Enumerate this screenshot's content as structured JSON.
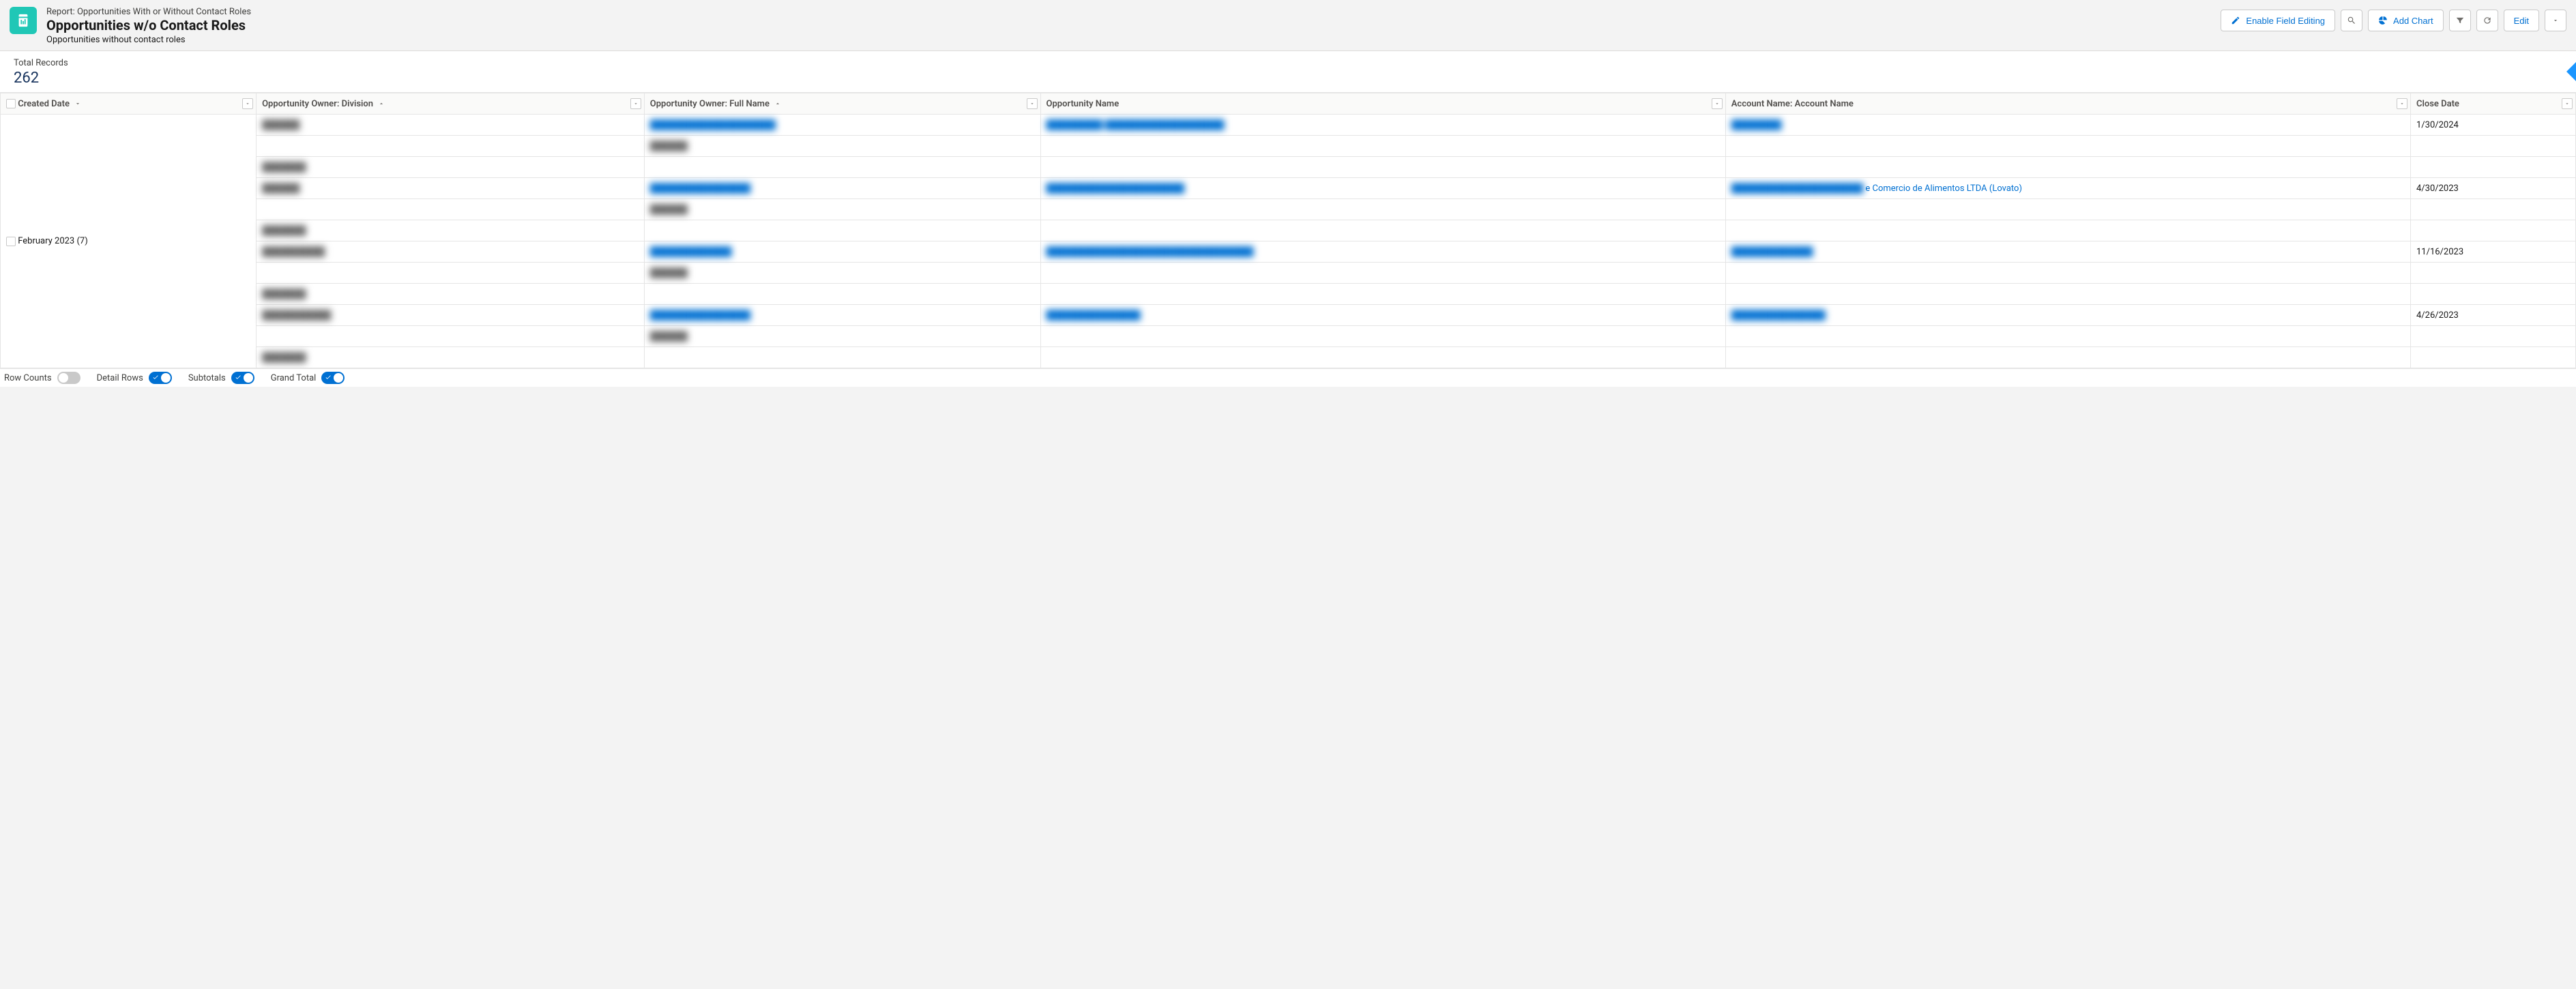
{
  "header": {
    "type_label": "Report: Opportunities With or Without Contact Roles",
    "title": "Opportunities w/o Contact Roles",
    "description": "Opportunities without contact roles",
    "actions": {
      "enable_editing": "Enable Field Editing",
      "add_chart": "Add Chart",
      "edit": "Edit"
    }
  },
  "summary": {
    "label": "Total Records",
    "value": "262"
  },
  "columns": {
    "created_date": "Created Date",
    "division": "Opportunity Owner: Division",
    "fullname": "Opportunity Owner: Full Name",
    "opp_name": "Opportunity Name",
    "account": "Account Name: Account Name",
    "close_date": "Close Date"
  },
  "group": {
    "label": "February 2023",
    "count": "(7)"
  },
  "rows": [
    {
      "division": "██████",
      "fullname": "████████████████████",
      "opp_name": "█████████   ███████████████████",
      "account": "████████",
      "close_date": "1/30/2024"
    },
    {
      "division": "",
      "fullname": "██████",
      "opp_name": "",
      "account": "",
      "close_date": ""
    },
    {
      "division": "███████",
      "fullname": "",
      "opp_name": "",
      "account": "",
      "close_date": ""
    },
    {
      "division": "██████",
      "fullname": "████████████████",
      "opp_name": "██████████████████████",
      "account_prefix": "█████████████████████",
      "account_suffix": " e Comercio de Alimentos LTDA (Lovato)",
      "close_date": "4/30/2023"
    },
    {
      "division": "",
      "fullname": "██████",
      "opp_name": "",
      "account": "",
      "close_date": ""
    },
    {
      "division": "███████",
      "fullname": "",
      "opp_name": "",
      "account": "",
      "close_date": ""
    },
    {
      "division": "██████████",
      "fullname": "█████████████",
      "opp_name": "█████████████████████████████████",
      "account": "█████████████",
      "close_date": "11/16/2023"
    },
    {
      "division": "",
      "fullname": "██████",
      "opp_name": "",
      "account": "",
      "close_date": ""
    },
    {
      "division": "███████",
      "fullname": "",
      "opp_name": "",
      "account": "",
      "close_date": ""
    },
    {
      "division": "███████████",
      "fullname": "████████████████",
      "opp_name": "███████████████",
      "account": "███████████████",
      "close_date": "4/26/2023"
    },
    {
      "division": "",
      "fullname": "██████",
      "opp_name": "",
      "account": "",
      "close_date": ""
    },
    {
      "division": "███████",
      "fullname": "",
      "opp_name": "",
      "account": "",
      "close_date": ""
    }
  ],
  "footer": {
    "row_counts": "Row Counts",
    "detail_rows": "Detail Rows",
    "subtotals": "Subtotals",
    "grand_total": "Grand Total"
  }
}
